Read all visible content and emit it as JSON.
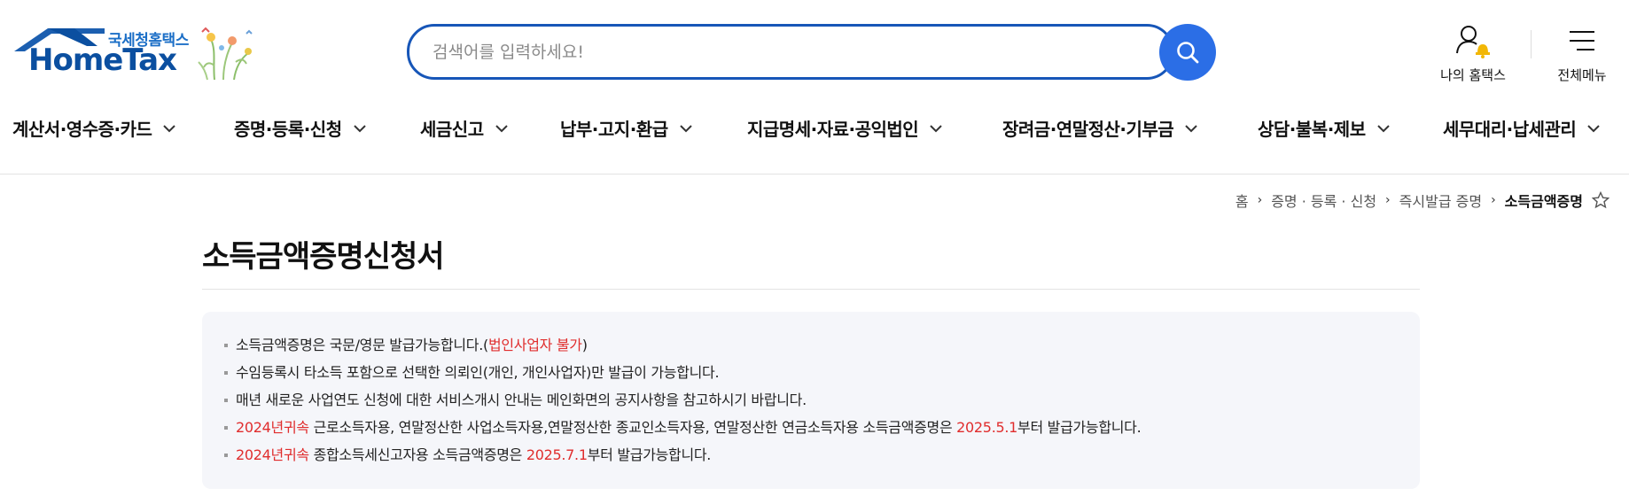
{
  "header": {
    "logo_sub": "국세청홈택스",
    "logo_main": "HomeTax",
    "search_placeholder": "검색어를 입력하세요!",
    "my_hometax_label": "나의 홈택스",
    "all_menu_label": "전체메뉴"
  },
  "gnb": {
    "items": [
      {
        "label": "계산서·영수증·카드"
      },
      {
        "label": "증명·등록·신청"
      },
      {
        "label": "세금신고"
      },
      {
        "label": "납부·고지·환급"
      },
      {
        "label": "지급명세·자료·공익법인"
      },
      {
        "label": "장려금·연말정산·기부금"
      },
      {
        "label": "상담·불복·제보"
      },
      {
        "label": "세무대리·납세관리"
      }
    ]
  },
  "breadcrumb": {
    "items": [
      "홈",
      "증명 · 등록 · 신청",
      "즉시발급 증명",
      "소득금액증명"
    ]
  },
  "page": {
    "title": "소득금액증명신청서"
  },
  "notice": {
    "items": [
      {
        "parts": [
          {
            "text": "소득금액증명은 국문/영문 발급가능합니다.(",
            "red": false
          },
          {
            "text": "법인사업자 불가",
            "red": true
          },
          {
            "text": ")",
            "red": false
          }
        ]
      },
      {
        "parts": [
          {
            "text": "수임등록시 타소득 포함으로 선택한 의뢰인(개인, 개인사업자)만 발급이 가능합니다.",
            "red": false
          }
        ]
      },
      {
        "parts": [
          {
            "text": "매년 새로운 사업연도 신청에 대한 서비스개시 안내는 메인화면의 공지사항을 참고하시기 바랍니다.",
            "red": false
          }
        ]
      },
      {
        "parts": [
          {
            "text": "2024년귀속",
            "red": true
          },
          {
            "text": " 근로소득자용, 연말정산한 사업소득자용,연말정산한 종교인소득자용, 연말정산한 연금소득자용 소득금액증명은 ",
            "red": false
          },
          {
            "text": "2025.5.1",
            "red": true
          },
          {
            "text": "부터 발급가능합니다.",
            "red": false
          }
        ]
      },
      {
        "parts": [
          {
            "text": "2024년귀속",
            "red": true
          },
          {
            "text": " 종합소득세신고자용 소득금액증명은 ",
            "red": false
          },
          {
            "text": "2025.7.1",
            "red": true
          },
          {
            "text": "부터 발급가능합니다.",
            "red": false
          }
        ]
      }
    ]
  },
  "colors": {
    "brand_blue": "#0b4fa0",
    "search_border": "#1756b8",
    "search_button": "#2b6ee6",
    "highlight_red": "#e02d2d",
    "notice_bg": "#f5f6fa"
  }
}
